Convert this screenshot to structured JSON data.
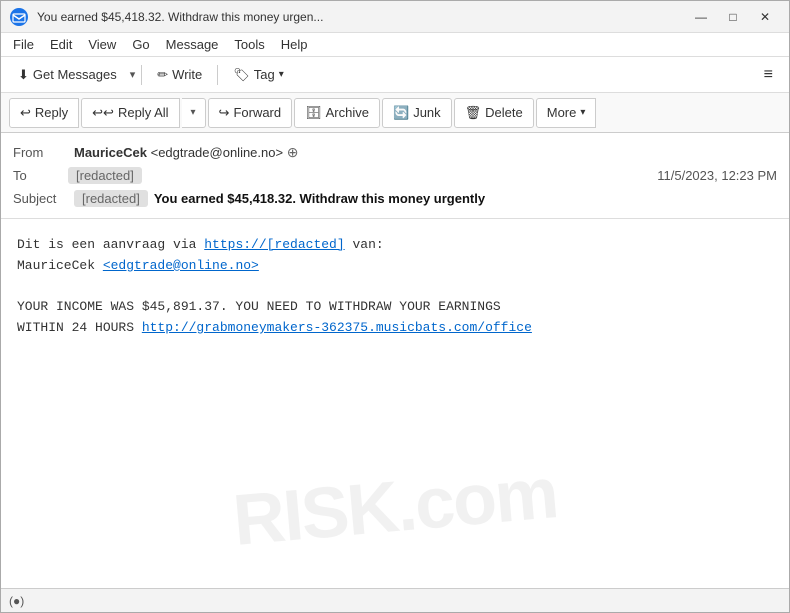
{
  "window": {
    "title": "You earned $45,418.32. Withdraw this money urgen...",
    "minimize_label": "—",
    "maximize_label": "□",
    "close_label": "✕"
  },
  "menubar": {
    "items": [
      {
        "id": "file",
        "label": "File"
      },
      {
        "id": "edit",
        "label": "Edit"
      },
      {
        "id": "view",
        "label": "View"
      },
      {
        "id": "go",
        "label": "Go"
      },
      {
        "id": "message",
        "label": "Message"
      },
      {
        "id": "tools",
        "label": "Tools"
      },
      {
        "id": "help",
        "label": "Help"
      }
    ]
  },
  "toolbar_top": {
    "get_messages_label": "Get Messages",
    "write_label": "Write",
    "tag_label": "Tag"
  },
  "toolbar_actions": {
    "reply_label": "Reply",
    "reply_all_label": "Reply All",
    "forward_label": "Forward",
    "archive_label": "Archive",
    "junk_label": "Junk",
    "delete_label": "Delete",
    "more_label": "More"
  },
  "email": {
    "from_label": "From",
    "from_name": "MauriceCek",
    "from_email": "<edgtrade@online.no>",
    "to_label": "To",
    "to_value": "[redacted]",
    "date": "11/5/2023, 12:23 PM",
    "subject_label": "Subject",
    "subject_prefix": "[redacted]",
    "subject_text": "You earned $45,418.32. Withdraw this money urgently",
    "body_line1": "Dit is een aanvraag via ",
    "body_link1": "https://[redacted]",
    "body_line1_suffix": " van:",
    "body_line2": "MauriceCek ",
    "body_link2": "<edgtrade@online.no>",
    "body_line3": "",
    "body_line4": "YOUR INCOME WAS $45,891.37. YOU NEED TO WITHDRAW YOUR EARNINGS",
    "body_line5": "WITHIN 24 HOURS ",
    "body_link3": "http://grabmoneymakers-362375.musicbats.com/office",
    "watermark": "RISK.com"
  },
  "status_bar": {
    "icon": "(●)"
  },
  "icons": {
    "get_messages": "⬇",
    "write": "✏",
    "tag": "🏷",
    "reply": "↩",
    "reply_all": "↩↩",
    "forward": "↪",
    "archive": "🗄",
    "junk": "🔄",
    "delete": "🗑",
    "security": "⊕",
    "dropdown": "▾",
    "hamburger": "≡"
  }
}
